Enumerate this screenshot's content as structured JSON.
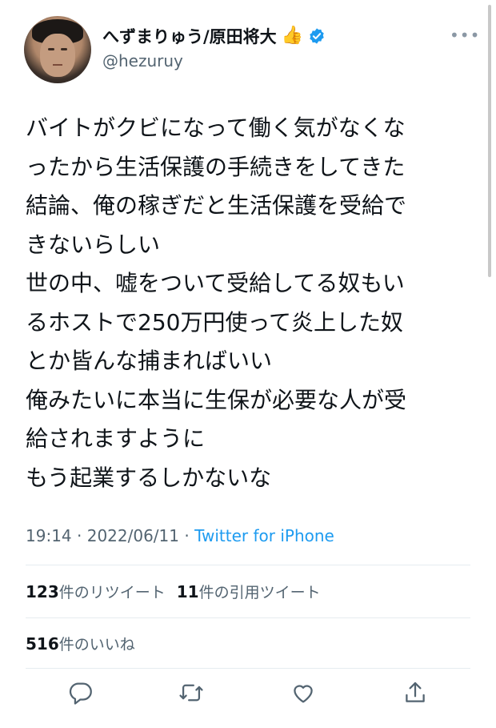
{
  "user": {
    "display_name": "へずまりゅう/原田将大",
    "emoji": "👍",
    "handle": "@hezuruy",
    "verified": true
  },
  "tweet": {
    "lines": [
      "バイトがクビになって働く気がなくな",
      "ったから生活保護の手続きをしてきた",
      "結論、俺の稼ぎだと生活保護を受給で",
      "きないらしい",
      "世の中、嘘をついて受給してる奴もい",
      "るホストで250万円使って炎上した奴",
      "とか皆んな捕まればいい",
      "俺みたいに本当に生保が必要な人が受",
      "給されますように",
      "もう起業するしかないな"
    ],
    "time": "19:14",
    "date": "2022/06/11",
    "separator": "·",
    "source": "Twitter for iPhone"
  },
  "stats": {
    "retweets_count": "123",
    "retweets_label": "件のリツイート",
    "quotes_count": "11",
    "quotes_label": "件の引用ツイート",
    "likes_count": "516",
    "likes_label": "件のいいね"
  },
  "icons": {
    "more": "more-icon",
    "reply": "reply-icon",
    "retweet": "retweet-icon",
    "like": "like-icon",
    "share": "share-icon",
    "verified": "verified-badge-icon"
  },
  "colors": {
    "text": "#0f1419",
    "secondary": "#536471",
    "accent": "#1d9bf0",
    "divider": "#e6ecf0"
  }
}
